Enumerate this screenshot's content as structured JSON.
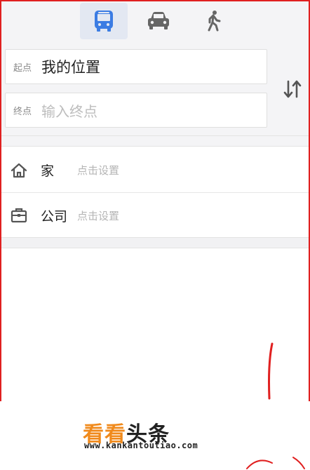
{
  "modes": [
    {
      "name": "bus",
      "icon": "bus-icon",
      "active": true
    },
    {
      "name": "car",
      "icon": "car-icon",
      "active": false
    },
    {
      "name": "walk",
      "icon": "walk-icon",
      "active": false
    }
  ],
  "route": {
    "start_label": "起点",
    "start_value": "我的位置",
    "end_label": "终点",
    "end_placeholder": "输入终点",
    "swap_icon": "swap-icon"
  },
  "places": [
    {
      "icon": "home-icon",
      "label": "家",
      "hint": "点击设置"
    },
    {
      "icon": "briefcase-icon",
      "label": "公司",
      "hint": "点击设置"
    }
  ],
  "watermark": {
    "brand_orange": "看看",
    "brand_dark": "头条",
    "url": "www.kankantoutiao.com"
  },
  "colors": {
    "accent": "#3b7ce3",
    "brand_orange": "#f08a1c",
    "border_red": "#e02020"
  }
}
